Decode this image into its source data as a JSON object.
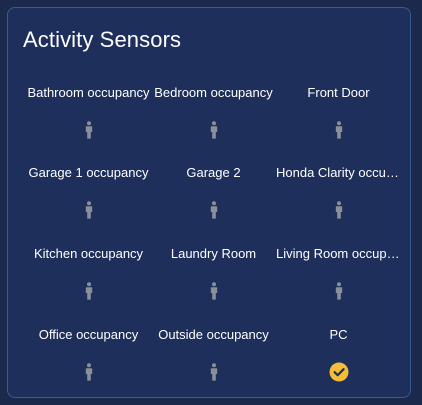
{
  "card": {
    "title": "Activity Sensors"
  },
  "colors": {
    "page_background": "#1b2a4c",
    "card_background": "#1d2f5a",
    "card_border": "#3b5b91",
    "idle_icon": "#8a8f99",
    "active_icon": "#f4bd39"
  },
  "sensors": [
    {
      "name": "Bathroom occupancy",
      "icon": "person-icon",
      "state": "idle"
    },
    {
      "name": "Bedroom occupancy",
      "icon": "person-icon",
      "state": "idle"
    },
    {
      "name": "Front Door",
      "icon": "person-icon",
      "state": "idle"
    },
    {
      "name": "Garage 1 occupancy",
      "icon": "person-icon",
      "state": "idle"
    },
    {
      "name": "Garage 2",
      "icon": "person-icon",
      "state": "idle"
    },
    {
      "name": "Honda Clarity occupancy",
      "icon": "person-icon",
      "state": "idle"
    },
    {
      "name": "Kitchen occupancy",
      "icon": "person-icon",
      "state": "idle"
    },
    {
      "name": "Laundry Room",
      "icon": "person-icon",
      "state": "idle"
    },
    {
      "name": "Living Room occupancy",
      "icon": "person-icon",
      "state": "idle"
    },
    {
      "name": "Office occupancy",
      "icon": "person-icon",
      "state": "idle"
    },
    {
      "name": "Outside occupancy",
      "icon": "person-icon",
      "state": "idle"
    },
    {
      "name": "PC",
      "icon": "check-circle-icon",
      "state": "active"
    }
  ]
}
